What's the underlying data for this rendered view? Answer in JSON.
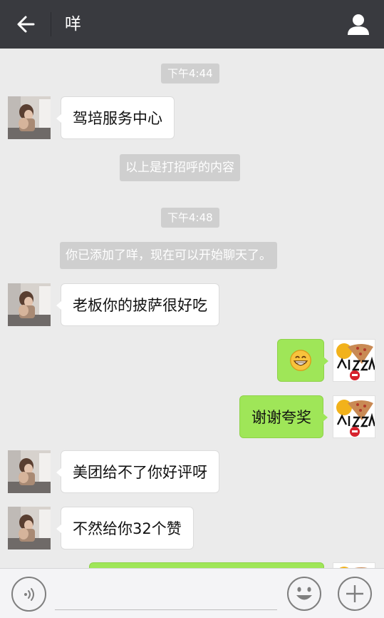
{
  "header": {
    "title": "咩",
    "back_icon": "arrow-left-icon",
    "profile_icon": "user-icon"
  },
  "messages": [
    {
      "type": "timestamp",
      "text": "下午4:44"
    },
    {
      "type": "incoming",
      "text": "驾培服务中心"
    },
    {
      "type": "system",
      "text": "以上是打招呼的内容"
    },
    {
      "type": "timestamp",
      "text": "下午4:48"
    },
    {
      "type": "system",
      "text": "你已添加了咩，现在可以开始聊天了。"
    },
    {
      "type": "incoming",
      "text": "老板你的披萨很好吃"
    },
    {
      "type": "outgoing",
      "text": "",
      "sticker": "grinning-face-emoji"
    },
    {
      "type": "outgoing",
      "text": "谢谢夸奖"
    },
    {
      "type": "incoming",
      "text": "美团给不了你好评呀"
    },
    {
      "type": "incoming",
      "text": "不然给你32个赞"
    },
    {
      "type": "outgoing",
      "text": "",
      "partially_visible": true
    }
  ],
  "inputbar": {
    "value": "",
    "voice_icon": "voice-icon",
    "emoji_icon": "smiley-icon",
    "more_icon": "plus-icon"
  },
  "colors": {
    "header_bg": "#393a3f",
    "chat_bg": "#ebebeb",
    "outgoing_bubble": "#9fe658",
    "incoming_bubble": "#ffffff",
    "timestamp_bg": "#cfcfcf"
  }
}
